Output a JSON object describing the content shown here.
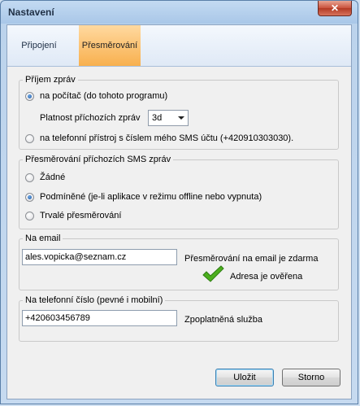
{
  "window": {
    "title": "Nastavení",
    "close_glyph": "✕"
  },
  "tabs": [
    {
      "label": "Připojení",
      "selected": false
    },
    {
      "label": "Přesměrování",
      "selected": true
    }
  ],
  "receive": {
    "legend": "Příjem zpráv",
    "to_computer": "na počítač (do tohoto programu)",
    "validity_label": "Platnost příchozích zpráv",
    "validity_value": "3d",
    "to_phone": "na telefonní přístroj s číslem mého SMS účtu (+420910303030).",
    "selected": "to_computer"
  },
  "redirect": {
    "legend": "Přesměrování příchozích SMS zpráv",
    "none": "Žádné",
    "conditional": "Podmíněné (je-li aplikace v režimu offline nebo vypnuta)",
    "permanent": "Trvalé přesměrování",
    "selected": "conditional"
  },
  "email": {
    "legend": "Na email",
    "value": "ales.vopicka@seznam.cz",
    "note": "Přesměrování na email je zdarma",
    "verified": "Adresa je ověřena"
  },
  "phone": {
    "legend": "Na telefonní číslo (pevné i mobilní)",
    "value": "+420603456789",
    "note": "Zpoplatněná služba"
  },
  "buttons": {
    "save": "Uložit",
    "cancel": "Storno"
  },
  "colors": {
    "active_tab": "#f8b04e",
    "check": "#4caf1e",
    "close": "#c9513c"
  }
}
